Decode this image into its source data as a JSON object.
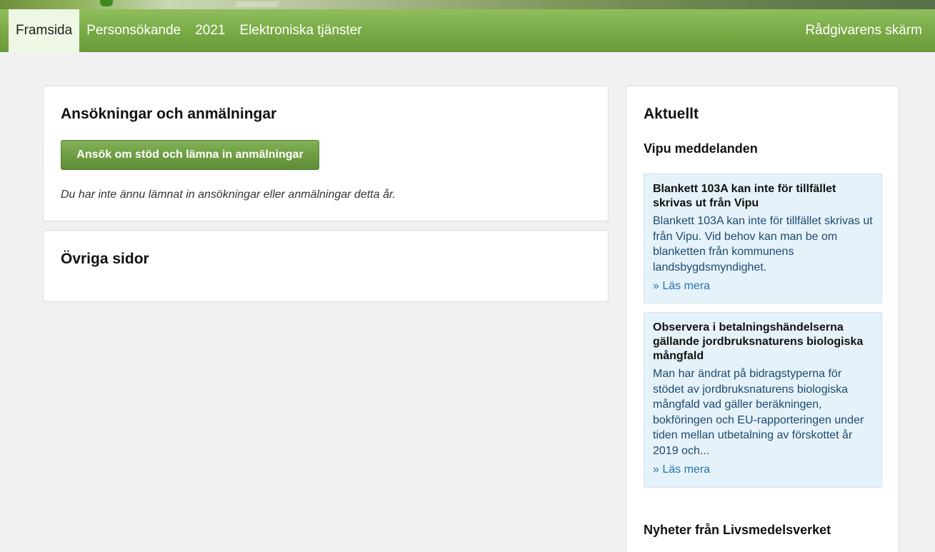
{
  "nav": {
    "items": [
      "Framsida",
      "Personsökande",
      "2021",
      "Elektroniska tjänster"
    ],
    "right": "Rådgivarens skärm"
  },
  "applications": {
    "title": "Ansökningar och anmälningar",
    "button": "Ansök om stöd och lämna in anmälningar",
    "note": "Du har inte ännu lämnat in ansökningar eller anmälningar detta år."
  },
  "other": {
    "title": "Övriga sidor"
  },
  "news": {
    "title": "Aktuellt",
    "vipu_title": "Vipu meddelanden",
    "messages": [
      {
        "title": "Blankett 103A kan inte för tillfället skrivas ut från Vipu",
        "body": "Blankett 103A kan inte för tillfället skrivas ut från Vipu. Vid behov kan man be om blanketten från kommunens landsbygdsmyndighet.",
        "more": "» Läs mera"
      },
      {
        "title": "Observera i betalningshändelserna gällande jordbruksnaturens biologiska mångfald",
        "body": "Man har ändrat på bidragstyperna för stödet av jordbruksnaturens biologiska mångfald vad gäller beräkningen, bokföringen och EU-rapporteringen under tiden mellan utbetalning av förskottet år 2019 och...",
        "more": "» Läs mera"
      }
    ],
    "lmv_title": "Nyheter från Livsmedelsverket"
  },
  "colors": {
    "nav_green": "#79a945",
    "button_green": "#6e9c43",
    "message_bg": "#e6f2fa",
    "link_blue": "#2273b5"
  }
}
